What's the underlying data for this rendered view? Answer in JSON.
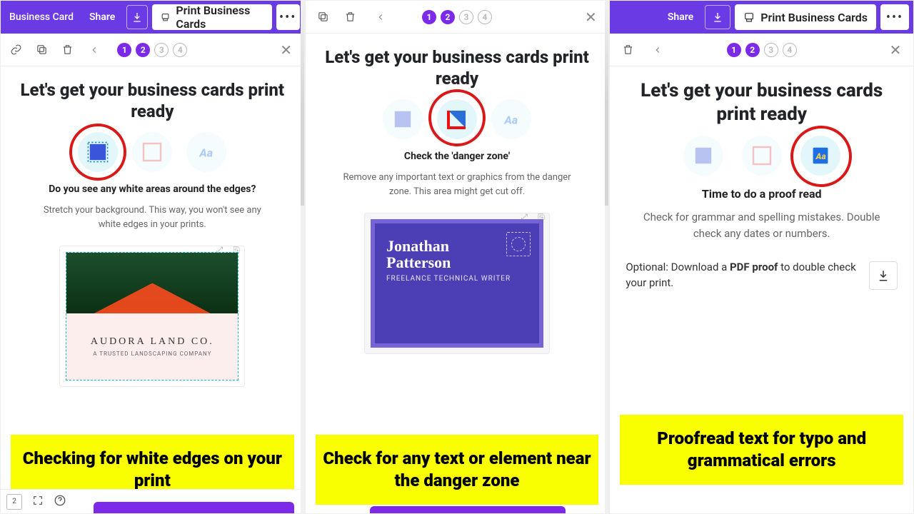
{
  "topbar": {
    "doc_title": "Business Card",
    "share": "Share",
    "print": "Print Business Cards"
  },
  "wizard": {
    "title": "Let's get your business cards print ready",
    "steps": [
      "1",
      "2",
      "3",
      "4"
    ]
  },
  "step1": {
    "question": "Do you see any white areas around the edges?",
    "hint": "Stretch your background. This way, you won't see any white edges in your prints.",
    "card_brand": "AUDORA LAND CO.",
    "card_tag": "A TRUSTED LANDSCAPING COMPANY"
  },
  "step2": {
    "question": "Check the 'danger zone'",
    "hint": "Remove any important text or graphics from the danger zone. This area might get cut off.",
    "name1": "Jonathan",
    "name2": "Patterson",
    "role": "FREELANCE TECHNICAL WRITER"
  },
  "step3": {
    "question": "Time to do a proof read",
    "hint": "Check for grammar and spelling mistakes. Double check any dates or numbers.",
    "proof_pre": "Optional: Download a ",
    "proof_strong": "PDF proof",
    "proof_post": " to double check your print."
  },
  "captions": {
    "c1": "Checking for white edges on your print",
    "c2": "Check for any text or element near the danger zone",
    "c3": "Proofread text for typo and grammatical errors"
  }
}
